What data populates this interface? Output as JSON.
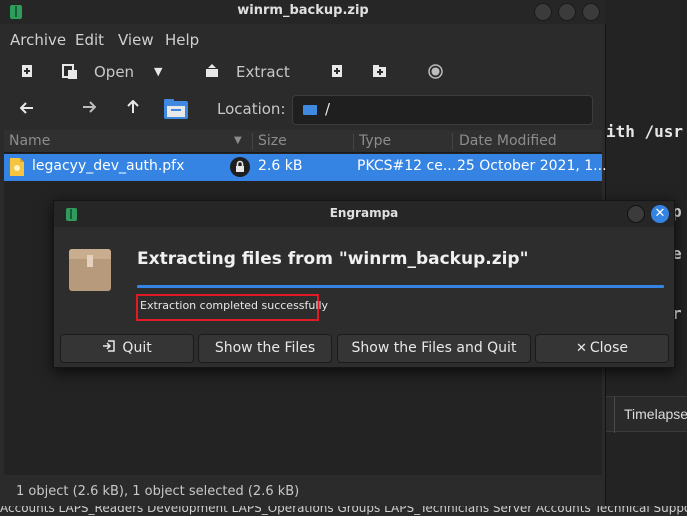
{
  "window": {
    "title": "winrm_backup.zip"
  },
  "menu": {
    "archive": "Archive",
    "edit": "Edit",
    "view": "View",
    "help": "Help"
  },
  "toolbar": {
    "open_label": "Open",
    "extract_label": "Extract"
  },
  "location": {
    "label": "Location:",
    "value": "/"
  },
  "columns": {
    "name": "Name",
    "size": "Size",
    "type": "Type",
    "modified": "Date Modified"
  },
  "files": [
    {
      "name": "legacyy_dev_auth.pfx",
      "size": "2.6 kB",
      "type": "PKCS#12 ce...",
      "modified": "25 October 2021, 1..."
    }
  ],
  "status_bar": {
    "text": "1 object (2.6 kB), 1 object selected (2.6 kB)"
  },
  "dialog": {
    "title": "Engrampa",
    "heading": "Extracting files from \"winrm_backup.zip\"",
    "progress": 1.0,
    "status": "Extraction completed successfully",
    "buttons": {
      "quit": "Quit",
      "show_files": "Show the Files",
      "show_files_quit": "Show the Files and Quit",
      "close": "Close"
    }
  },
  "background": {
    "terminal_line": "ith /usr",
    "tab_label": "Timelapse",
    "bottom_text": "Accounts LAPS_Readers Development LAPS_Operations Groups LAPS_Technicians Server Accounts Technical Support"
  },
  "colors": {
    "accent": "#3584e4",
    "highlight_border": "#e01b24"
  }
}
